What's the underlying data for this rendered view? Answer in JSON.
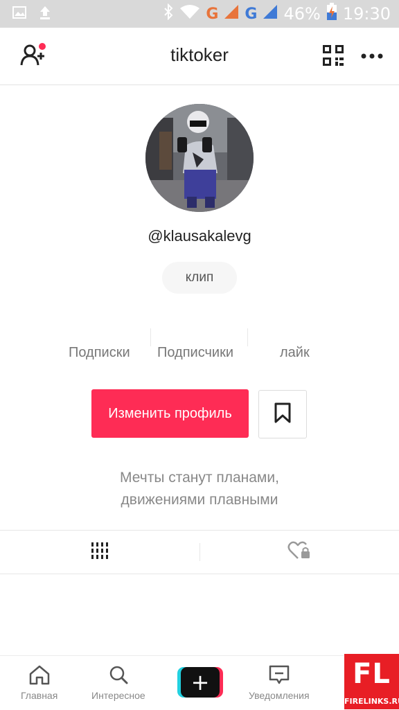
{
  "status_bar": {
    "network_g1": "G",
    "network_g2": "G",
    "battery_percent": "46%",
    "time": "19:30",
    "icons": [
      "image-icon",
      "upload-icon",
      "bluetooth-icon",
      "wifi-icon",
      "signal-icon",
      "battery-charging-icon"
    ]
  },
  "header": {
    "title": "tiktoker",
    "icons": [
      "add-user-icon",
      "qr-code-icon",
      "more-icon"
    ],
    "notification_dot_color": "#fe2c55"
  },
  "profile": {
    "handle": "@klausakalevg",
    "chip_label": "клип",
    "stats": {
      "following_label": "Подписки",
      "followers_label": "Подписчики",
      "likes_label": "лайк"
    },
    "edit_button_label": "Изменить профиль",
    "bio_line1": "Мечты станут планами,",
    "bio_line2": "движениями плавными"
  },
  "tabs": {
    "icons": [
      "grid-videos-icon",
      "liked-private-icon"
    ]
  },
  "bottom_nav": {
    "home_label": "Главная",
    "discover_label": "Интересное",
    "inbox_label": "Уведомления",
    "icons": [
      "home-icon",
      "search-icon",
      "plus-icon",
      "inbox-icon"
    ]
  },
  "watermark": {
    "big": "FL",
    "small": "FIRELINKS.RU"
  },
  "colors": {
    "accent": "#fe2c55",
    "cyan": "#22d1e0",
    "text": "#222222",
    "muted": "#888888"
  }
}
